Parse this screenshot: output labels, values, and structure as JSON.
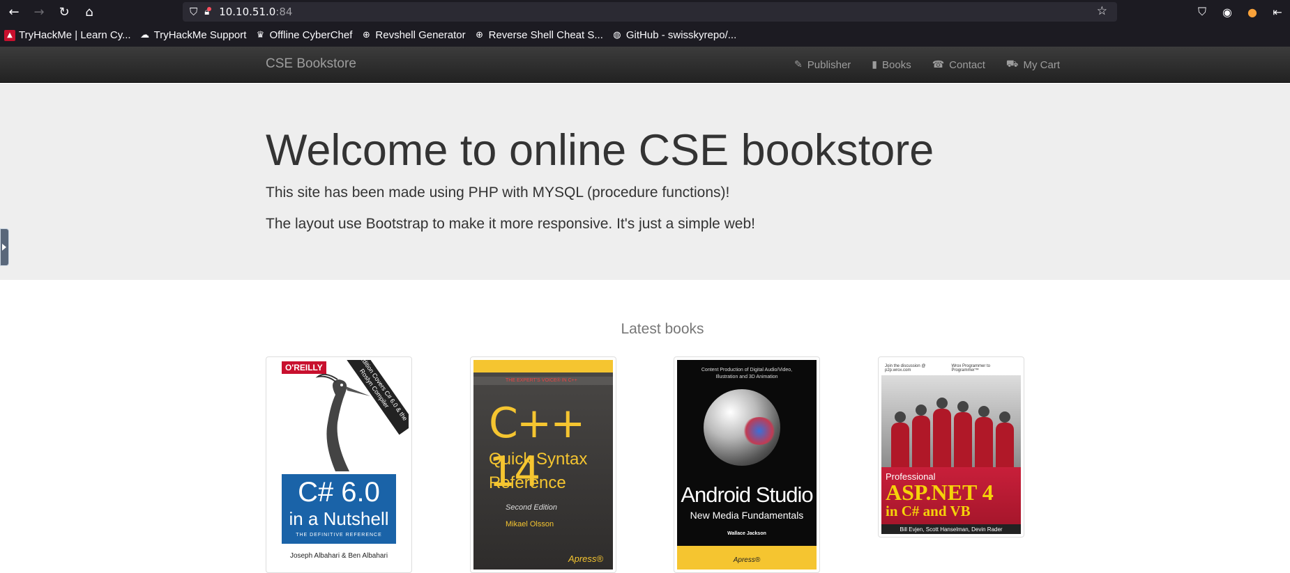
{
  "browser": {
    "url_host": "10.10.51.0",
    "url_port": ":84",
    "nav": {
      "back": "back-icon",
      "forward": "forward-icon",
      "reload": "reload-icon",
      "home": "home-icon"
    },
    "bookmarks": [
      {
        "label": "TryHackMe | Learn Cy...",
        "icon": "tryhackme-icon"
      },
      {
        "label": "TryHackMe Support",
        "icon": "cloud-icon"
      },
      {
        "label": "Offline CyberChef",
        "icon": "chef-icon"
      },
      {
        "label": "Revshell Generator",
        "icon": "globe-icon"
      },
      {
        "label": "Reverse Shell Cheat S...",
        "icon": "globe-icon"
      },
      {
        "label": "GitHub - swisskyrepo/...",
        "icon": "github-icon"
      }
    ]
  },
  "site": {
    "brand": "CSE Bookstore",
    "nav": [
      {
        "label": "Publisher",
        "icon": "paperclip-icon"
      },
      {
        "label": "Books",
        "icon": "book-icon"
      },
      {
        "label": "Contact",
        "icon": "phone-icon"
      },
      {
        "label": "My Cart",
        "icon": "cart-icon"
      }
    ],
    "hero": {
      "title": "Welcome to online CSE bookstore",
      "p1": "This site has been made using PHP with MYSQL (procedure functions)!",
      "p2": "The layout use Bootstrap to make it more responsive. It's just a simple web!"
    },
    "latest_title": "Latest books",
    "books": [
      {
        "publisher_badge": "O'REILLY",
        "ribbon": "6th Edition Covers C# 6.0 & the Roslyn Compiler",
        "title_line1": "C# 6.0",
        "title_line2": "in a Nutshell",
        "tagline": "THE DEFINITIVE REFERENCE",
        "authors": "Joseph Albahari & Ben Albahari"
      },
      {
        "series": "THE EXPERT'S VOICE® IN C++",
        "title_line1": "C++ 14",
        "title_line2": "Quick Syntax",
        "title_line3": "Reference",
        "edition": "Second Edition",
        "authors": "Mikael Olsson",
        "publisher": "Apress®"
      },
      {
        "top_line1": "Content Production of Digital Audio/Video,",
        "top_line2": "Illustration and 3D Animation",
        "title": "Android Studio",
        "subtitle": "New Media Fundamentals",
        "authors": "Wallace Jackson",
        "publisher": "Apress®"
      },
      {
        "top_left": "Join the discussion @ p2p.wrox.com",
        "top_right": "Wrox Programmer to Programmer™",
        "prefix": "Professional",
        "title": "ASP.NET 4",
        "subtitle": "in C# and VB",
        "authors": "Bill Evjen, Scott Hanselman, Devin Rader"
      }
    ]
  }
}
